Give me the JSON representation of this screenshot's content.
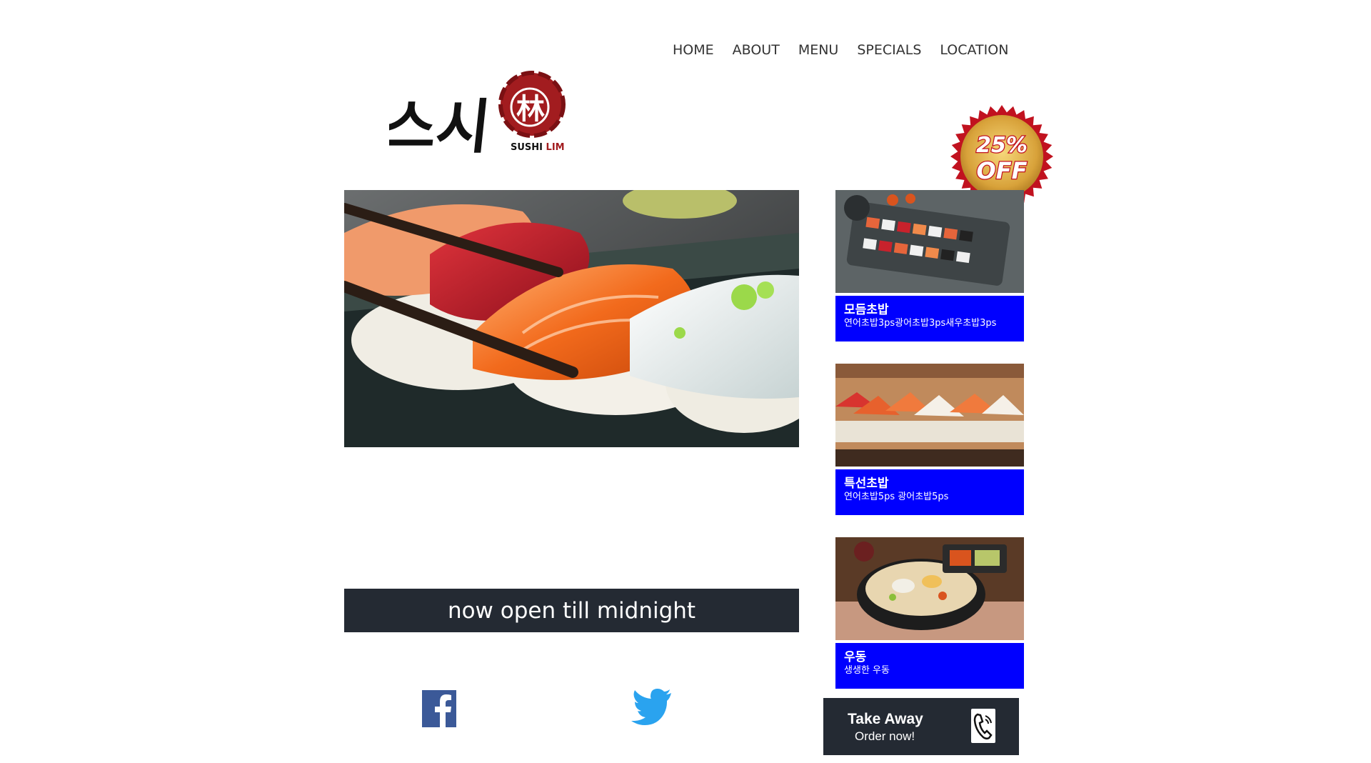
{
  "nav": {
    "items": [
      {
        "label": "HOME"
      },
      {
        "label": "ABOUT"
      },
      {
        "label": "MENU"
      },
      {
        "label": "SPECIALS"
      },
      {
        "label": "LOCATION"
      }
    ]
  },
  "logo": {
    "korean": "스시",
    "hanja": "林",
    "english": "SUSHI LIM",
    "colors": {
      "seal": "#a21c1f",
      "ink": "#111111"
    }
  },
  "badge": {
    "percent": "25%",
    "off": "OFF",
    "colors": {
      "border": "#c1121f",
      "gold": "#d8a23a"
    }
  },
  "banner": {
    "text": "now open till midnight",
    "color": "#242a33"
  },
  "specials": [
    {
      "name": "모듬초밥",
      "desc": "연어초밥3ps광어초밥3ps새우초밥3ps"
    },
    {
      "name": "특선초밥",
      "desc": "연어초밥5ps 광어초밥5ps"
    },
    {
      "name": "우동",
      "desc": "생생한 우동"
    }
  ],
  "caption_color": "#0000ff",
  "takeaway": {
    "title": "Take Away",
    "subtitle": "Order now!",
    "icon": "phone-icon"
  },
  "social": {
    "facebook_icon": "facebook-icon",
    "twitter_icon": "twitter-icon"
  }
}
